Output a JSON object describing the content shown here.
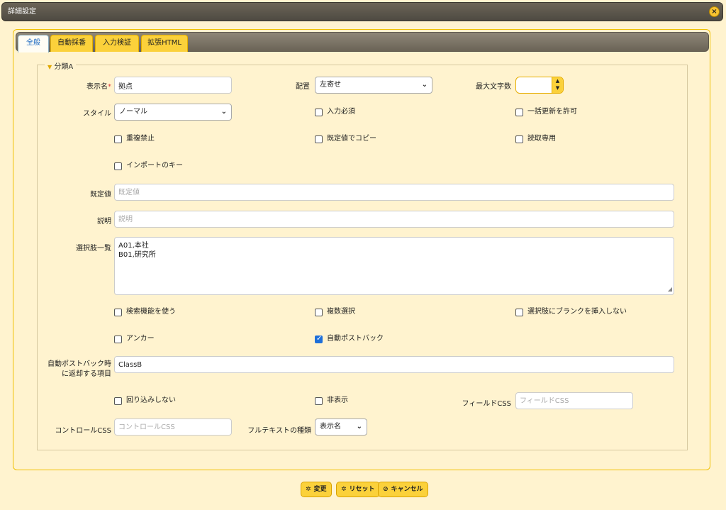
{
  "window": {
    "title": "詳細設定",
    "close_icon": "close-icon"
  },
  "tabs": [
    {
      "label": "全般",
      "active": true
    },
    {
      "label": "自動採番"
    },
    {
      "label": "入力検証"
    },
    {
      "label": "拡張HTML"
    }
  ],
  "section": {
    "legend": "分類A"
  },
  "fields": {
    "display_name": {
      "label": "表示名",
      "required_mark": "*",
      "value": "拠点"
    },
    "alignment": {
      "label": "配置",
      "value": "左寄せ"
    },
    "max_length": {
      "label": "最大文字数",
      "value": ""
    },
    "style": {
      "label": "スタイル",
      "value": "ノーマル"
    },
    "required": {
      "label": "入力必須",
      "checked": false
    },
    "bulk_update": {
      "label": "一括更新を許可",
      "checked": false
    },
    "no_duplicate": {
      "label": "重複禁止",
      "checked": false
    },
    "copy_default": {
      "label": "既定値でコピー",
      "checked": false
    },
    "read_only": {
      "label": "読取専用",
      "checked": false
    },
    "import_key": {
      "label": "インポートのキー",
      "checked": false
    },
    "default_value": {
      "label": "既定値",
      "placeholder": "既定値",
      "value": ""
    },
    "description": {
      "label": "説明",
      "placeholder": "説明",
      "value": ""
    },
    "choices": {
      "label": "選択肢一覧",
      "value": "A01,本社\nB01,研究所"
    },
    "use_search": {
      "label": "検索機能を使う",
      "checked": false
    },
    "multi_select": {
      "label": "複数選択",
      "checked": false
    },
    "no_blank": {
      "label": "選択肢にブランクを挿入しない",
      "checked": false
    },
    "anchor": {
      "label": "アンカー",
      "checked": false
    },
    "auto_postback": {
      "label": "自動ポストバック",
      "checked": true
    },
    "postback_items": {
      "label_line1": "自動ポストバック時",
      "label_line2": "に返却する項目",
      "value": "ClassB"
    },
    "no_wrap": {
      "label": "回り込みしない",
      "checked": false
    },
    "hidden": {
      "label": "非表示",
      "checked": false
    },
    "field_css": {
      "label": "フィールドCSS",
      "placeholder": "フィールドCSS",
      "value": ""
    },
    "control_css": {
      "label": "コントロールCSS",
      "placeholder": "コントロールCSS",
      "value": ""
    },
    "fulltext_type": {
      "label": "フルテキストの種類",
      "value": "表示名"
    }
  },
  "footer": {
    "change": {
      "label": "変更",
      "icon": "gear-icon"
    },
    "reset": {
      "label": "リセット",
      "icon": "gear-icon"
    },
    "cancel": {
      "label": "キャンセル",
      "icon": "cancel-icon"
    }
  }
}
